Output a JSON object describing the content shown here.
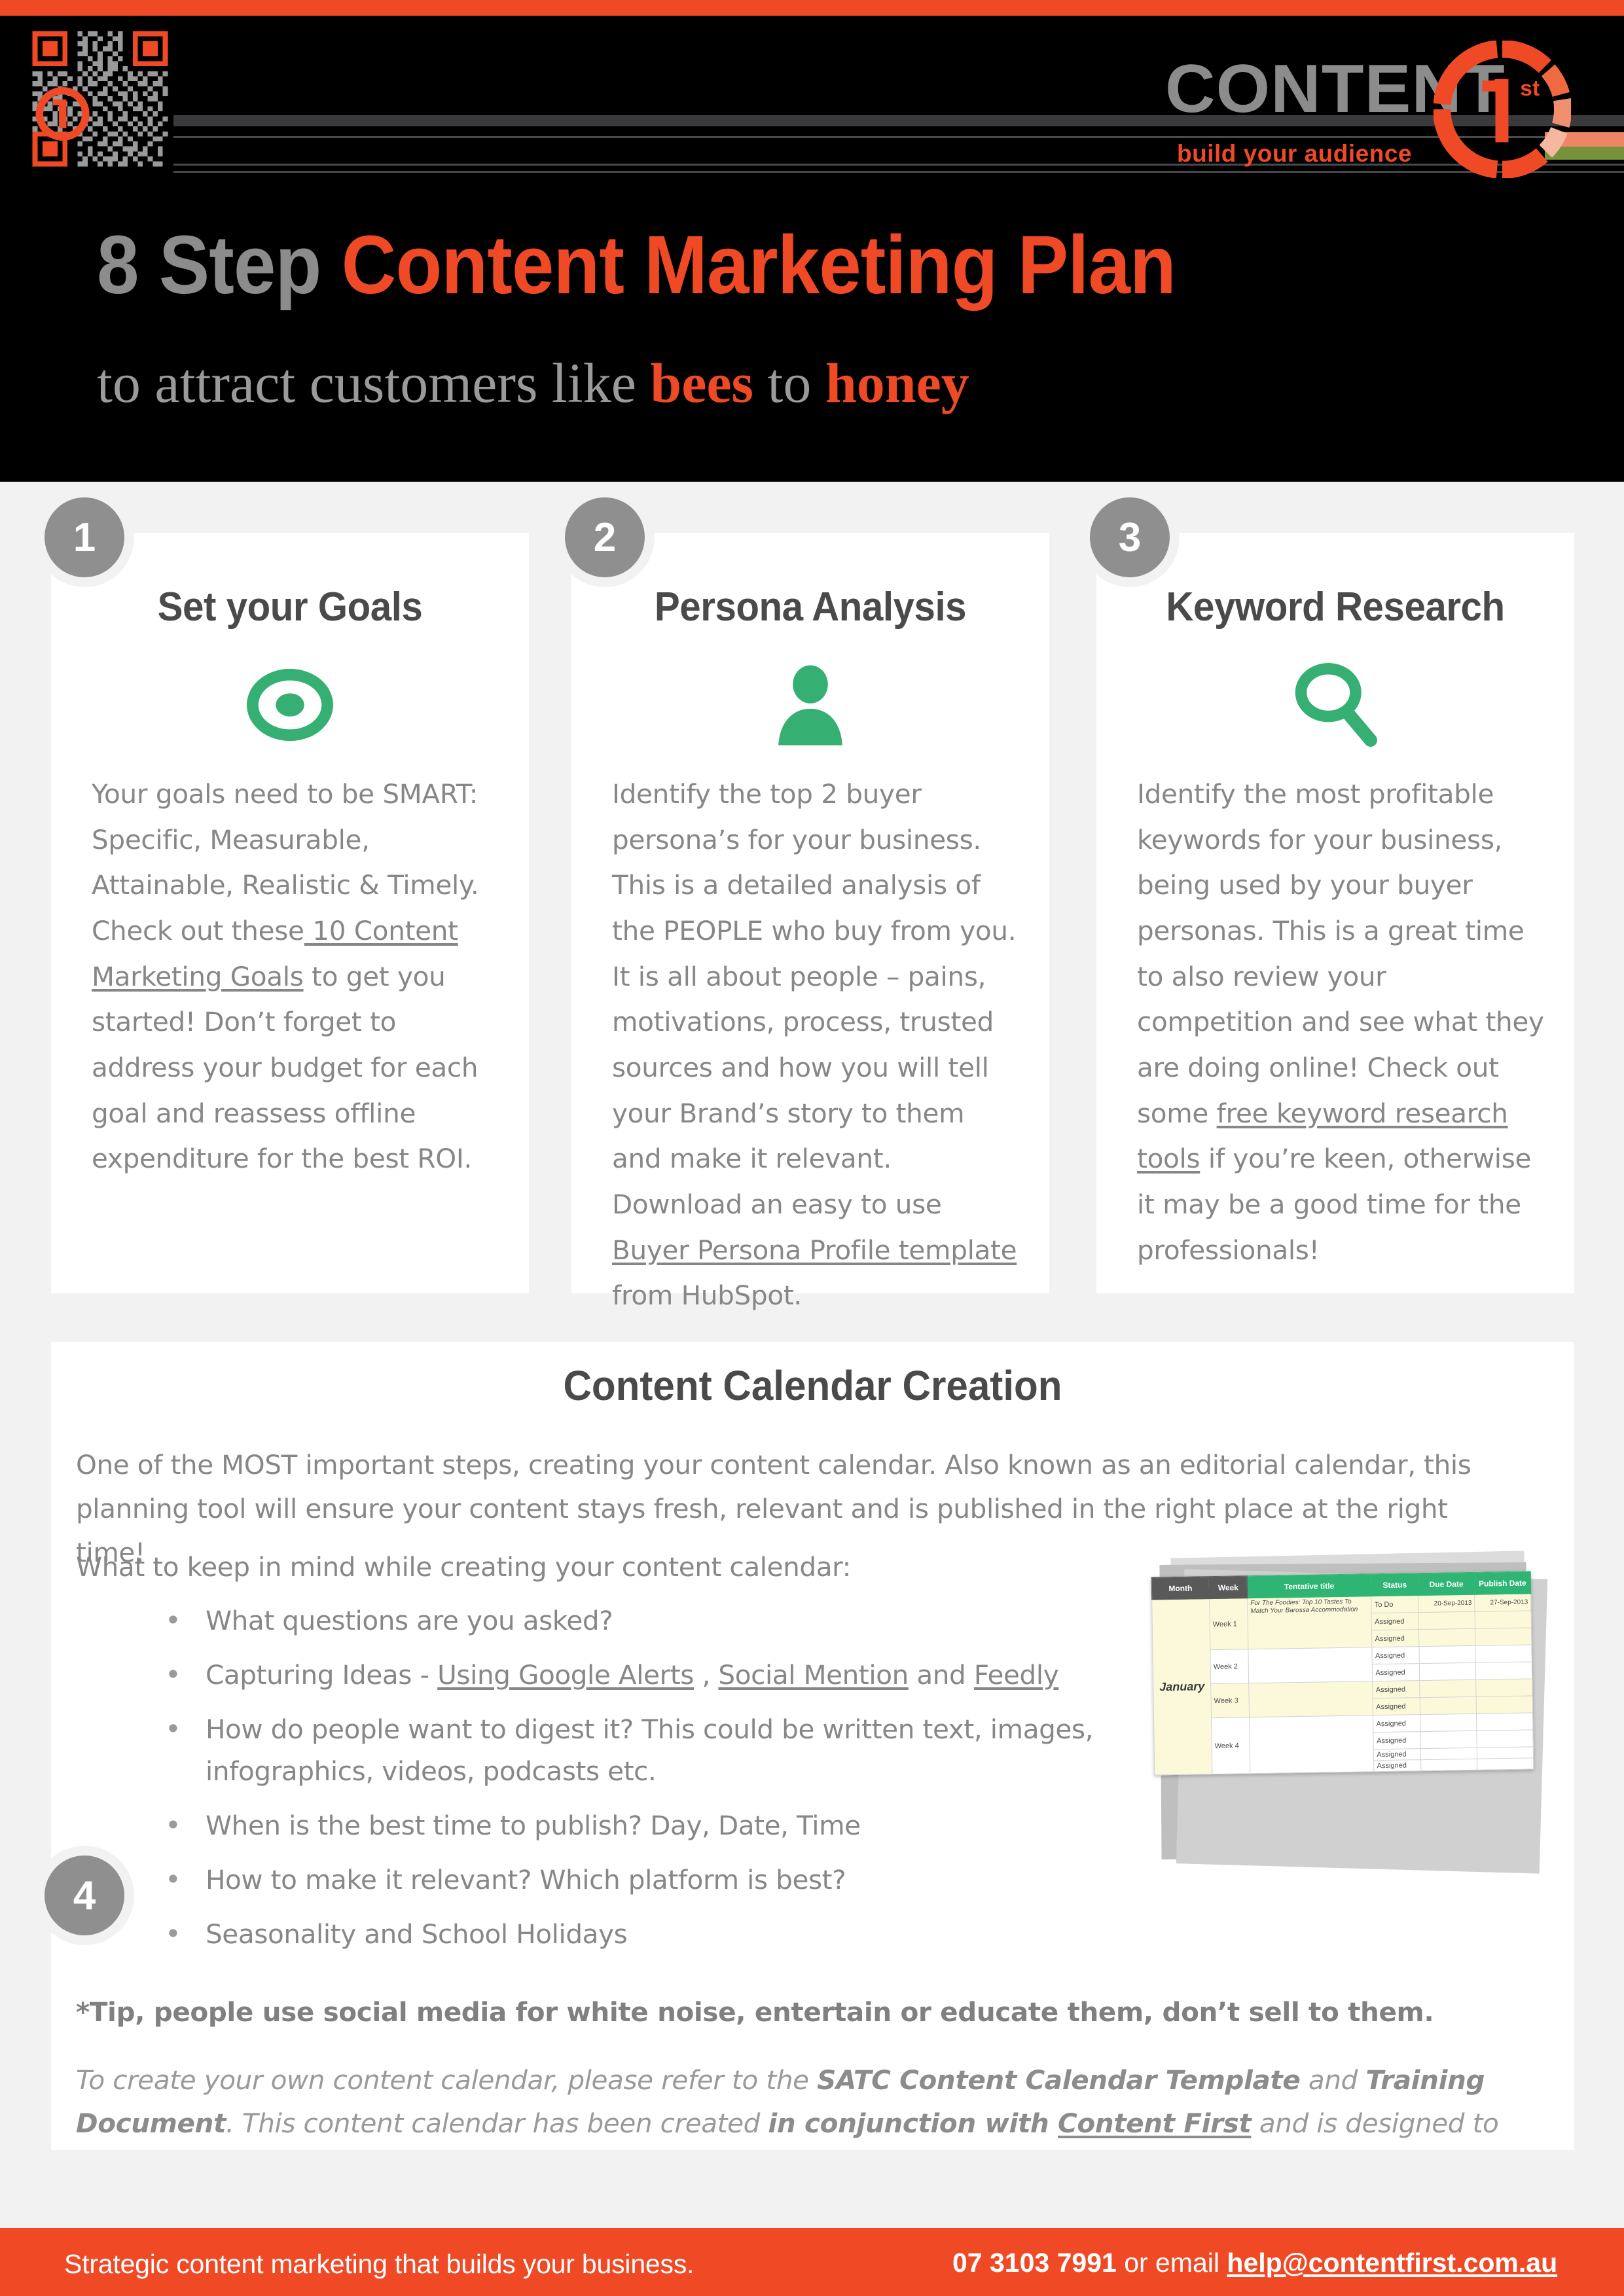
{
  "brand": {
    "accent_orange": "#ef4a25",
    "accent_green": "#35af72",
    "grey": "#8c8c8c",
    "logo_word": "CONTENT",
    "logo_superscript": "1st",
    "logo_tagline": "build your audience",
    "qr_label": "qr-code"
  },
  "title": {
    "part_grey": "8 Step ",
    "part_orange": "Content Marketing Plan",
    "sub_pre": "to attract customers like ",
    "sub_bold1": "bees",
    "sub_mid": " to ",
    "sub_bold2": "honey"
  },
  "steps": [
    {
      "number": "1",
      "title": "Set your Goals",
      "icon": "target-icon",
      "body_pre": "Your goals need to be SMART: Specific, Measurable, Attainable, Realistic & Timely. Check out these",
      "body_link": " 10 Content Marketing Goals",
      "body_post": " to get you started! Don’t forget to address your budget for each goal and reassess offline expenditure for the best ROI."
    },
    {
      "number": "2",
      "title": "Persona Analysis",
      "icon": "person-icon",
      "body_pre": "Identify the top 2 buyer persona’s for your business. This is a detailed analysis of the PEOPLE who buy from you.  It is all about people – pains, motivations, process, trusted sources and how you will tell your Brand’s story to them and make it relevant. Download an easy to use ",
      "body_link": "Buyer Persona Profile template",
      "body_post": " from HubSpot."
    },
    {
      "number": "3",
      "title": "Keyword Research",
      "icon": "search-icon",
      "body_pre": "Identify the most profitable keywords for your business, being used by your buyer personas. This is a great time to also review your competition and see what they are doing online! Check out some ",
      "body_link": "free keyword research tools",
      "body_post": " if you’re keen, otherwise it may be a good time for the professionals!"
    }
  ],
  "step4": {
    "number": "4",
    "title": "Content Calendar Creation",
    "intro": "One of the MOST important steps, creating your content calendar. Also known as an editorial calendar, this planning tool will ensure your content stays fresh, relevant and is published in the right place at the right time!",
    "lead": "What to keep in mind while creating your content calendar:",
    "bullets": [
      {
        "pre": "What questions are you asked?",
        "links": []
      },
      {
        "pre": "Capturing Ideas - ",
        "link1": "Using Google Alerts",
        "mid1": " , ",
        "link2": "Social Mention",
        "mid2": " and ",
        "link3": "Feedly"
      },
      {
        "pre": "How do people want to digest it? This could be written text, images, infographics, videos, podcasts etc.",
        "links": []
      },
      {
        "pre": "When is the best time to publish? Day, Date, Time",
        "links": []
      },
      {
        "pre": "How to make it relevant? Which platform is best?",
        "links": []
      },
      {
        "pre": "Seasonality and School Holidays",
        "links": []
      }
    ],
    "tip": "*Tip, people use social media for white noise, entertain or educate them, don’t sell to them.",
    "closing_a": "To create your own content calendar, please refer to the ",
    "closing_b1": "SATC Content Calendar Template",
    "closing_c": " and ",
    "closing_b2": "Training Document",
    "closing_d": ". This content calendar has been created ",
    "closing_b3": "in conjunction with ",
    "closing_link": "Content First",
    "closing_e": " and is designed to bring out the best content for building your audience!"
  },
  "calendar": {
    "headers": [
      "Month",
      "Week",
      "Tentative title",
      "Status",
      "Due Date",
      "Publish Date"
    ],
    "month": "January",
    "rows": [
      {
        "week": "Week 1",
        "title": "For The Foodies: Top 10 Tastes To Match Your Barossa Accommodation",
        "status": "To Do",
        "due": "20-Sep-2013",
        "publish": "27-Sep-2013",
        "highlight": true
      },
      {
        "week": "",
        "title": "",
        "status": "Assigned",
        "due": "",
        "publish": "",
        "highlight": true
      },
      {
        "week": "",
        "title": "",
        "status": "Assigned",
        "due": "",
        "publish": "",
        "highlight": true
      },
      {
        "week": "Week 2",
        "title": "",
        "status": "Assigned",
        "due": "",
        "publish": "",
        "highlight": false
      },
      {
        "week": "",
        "title": "",
        "status": "Assigned",
        "due": "",
        "publish": "",
        "highlight": false
      },
      {
        "week": "Week 3",
        "title": "",
        "status": "Assigned",
        "due": "",
        "publish": "",
        "highlight": true
      },
      {
        "week": "",
        "title": "",
        "status": "Assigned",
        "due": "",
        "publish": "",
        "highlight": true
      },
      {
        "week": "Week 4",
        "title": "",
        "status": "Assigned",
        "due": "",
        "publish": "",
        "highlight": false
      },
      {
        "week": "",
        "title": "",
        "status": "Assigned",
        "due": "",
        "publish": "",
        "highlight": false
      },
      {
        "week": "",
        "title": "",
        "status": "Assigned",
        "due": "",
        "publish": "",
        "highlight": false
      },
      {
        "week": "",
        "title": "",
        "status": "Assigned",
        "due": "",
        "publish": "",
        "highlight": false
      }
    ]
  },
  "footer": {
    "left": "Strategic content marketing that builds your business.",
    "phone": "07 3103 7991",
    "mid": " or email ",
    "email": "help@contentfirst.com.au"
  }
}
